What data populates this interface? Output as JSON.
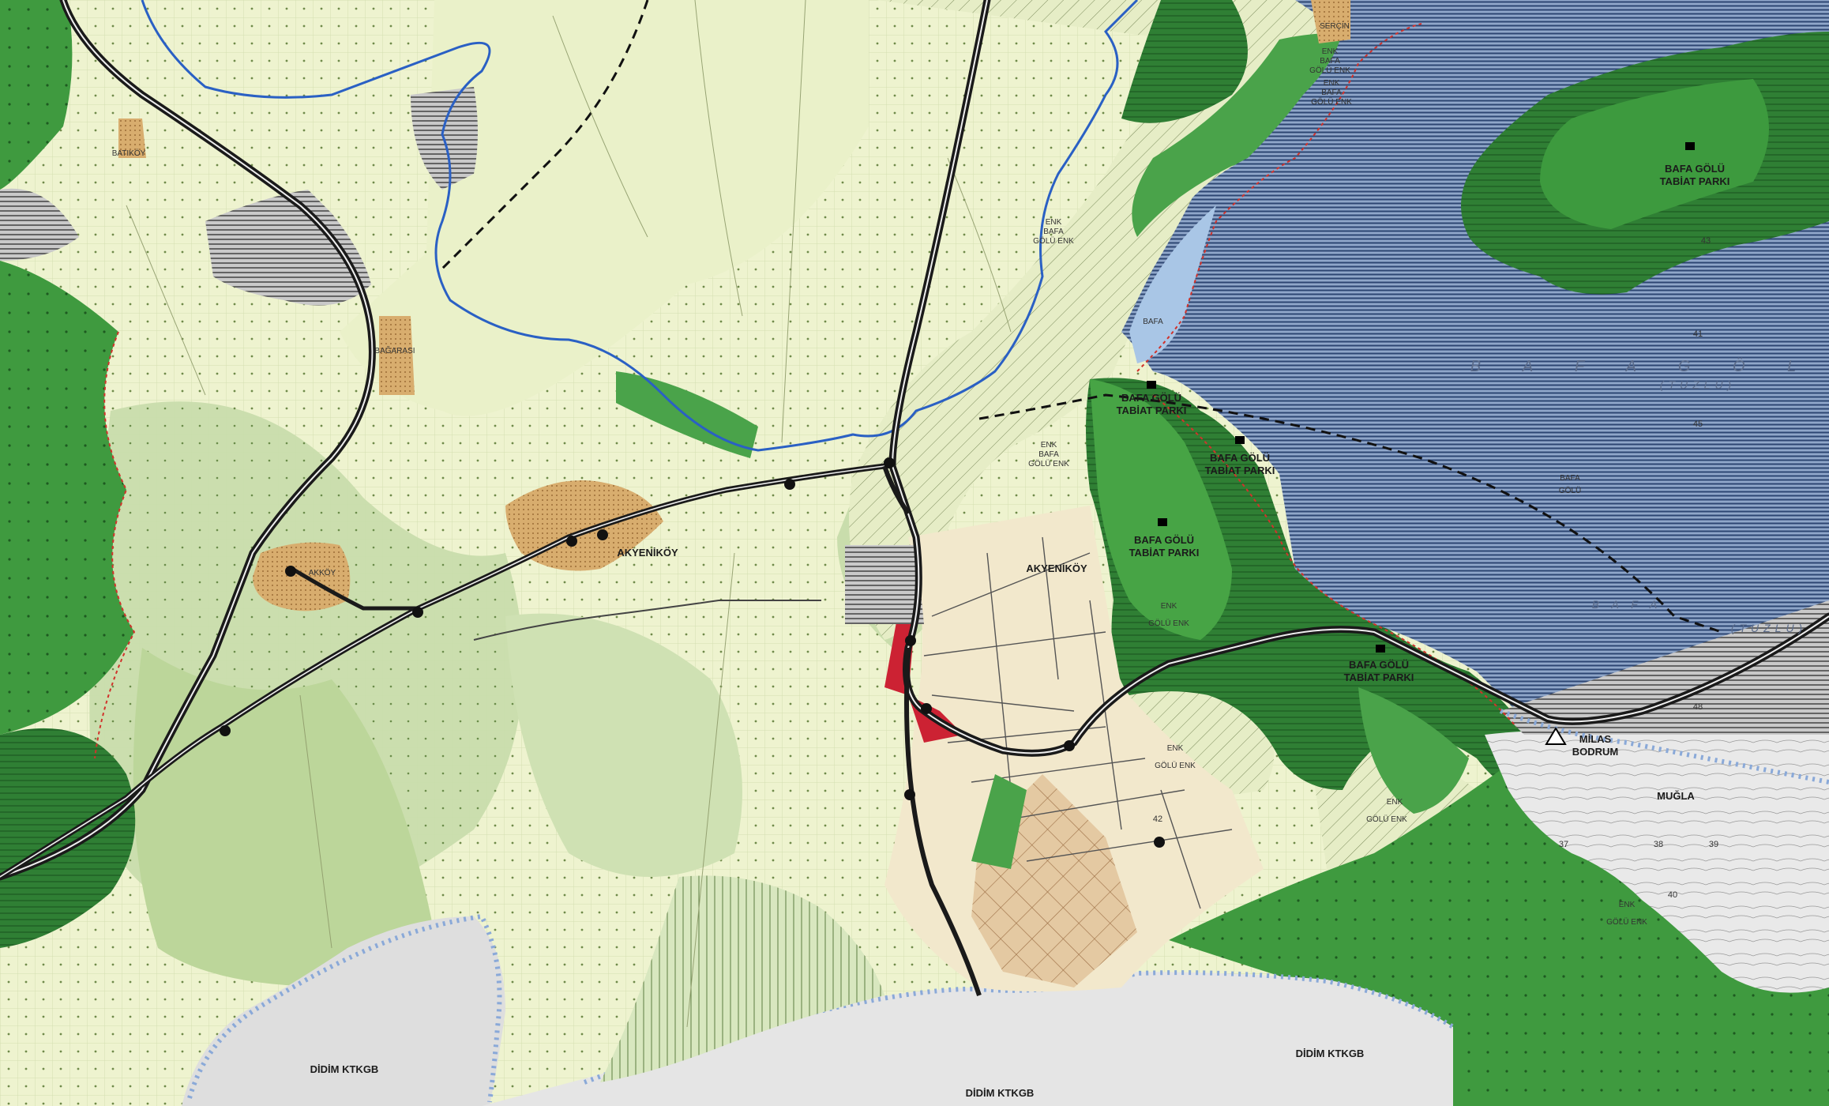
{
  "labels": {
    "batikoy": "BATIKÖY",
    "bagarasi": "BAĞARASI",
    "akyenikoy_village": "AKYENİKÖY",
    "akyenikoy_plan": "AKYENİKÖY",
    "akkoy": "AKKÖY",
    "sercin": "SERÇİN",
    "didim_left": "DİDİM KTKGB",
    "didim_center": "DİDİM KTKGB",
    "didim_right": "DİDİM KTKGB",
    "mugla": "MUĞLA",
    "milas": "MİLAS",
    "bodrum": "BODRUM",
    "bafa_lake_big": "B A F A   G Ö L",
    "bafa_lake_small": "B A F A",
    "tuzlu_1": "(TUZLU)",
    "tuzlu_2": "(TUZLU)",
    "bafa_golu_lake_1": "BAFA",
    "bafa_golu_lake_2": "GÖLÜ",
    "bafa_near_shore": "BAFA",
    "park_main_1": "BAFA GÖLÜ",
    "park_main_2": "TABİAT PARKI",
    "park_a_1": "BAFA GÖLÜ",
    "park_a_2": "TABİAT PARKI",
    "park_b_1": "BAFA GÖLÜ",
    "park_b_2": "TABİAT PARKI",
    "park_c_1": "BAFA GÖLÜ",
    "park_c_2": "TABİAT PARKI",
    "park_d_1": "BAFA GÖLÜ",
    "park_d_2": "TABİAT PARKI",
    "enk_top_1": "ENK",
    "enk_top_2": "BAFA",
    "enk_top_3": "GÖLÜ ENK",
    "enk_2_1": "ENK",
    "enk_2_2": "BAFA",
    "enk_2_3": "GÖLÜ ENK",
    "enk_3_1": "ENK",
    "enk_3_2": "BAFA",
    "enk_3_3": "GÖLÜ ENK",
    "enk_4_1": "ENK",
    "enk_4_2": "BAFA",
    "enk_4_3": "GÖLÜ ENK",
    "enk_5_1": "ENK",
    "enk_5_2": "GÖLÜ ENK",
    "enk_6_1": "ENK",
    "enk_6_2": "GÖLÜ ENK",
    "enk_7_1": "ENK",
    "enk_7_2": "GÖLÜ ENK",
    "enk_8_1": "ENK",
    "enk_8_2": "GÖLÜ ENK",
    "num_38": "38",
    "num_39": "39",
    "num_37": "37",
    "num_40": "40",
    "num_48": "48",
    "num_41": "41",
    "num_43": "43",
    "num_45": "45",
    "num_42": "42"
  },
  "colors": {
    "forest": "#3f9a3f",
    "forest_dark": "#2f7f34",
    "forest_light": "#5fb64f",
    "lake": "#3d5a8d",
    "lake_shallow": "#a9c6e6",
    "agri": "#eef3cf",
    "meadow": "#c5dca8",
    "settlement": "#d4a96a",
    "plan_area": "#f2e6c7",
    "industry": "#8b8b8b",
    "commercial": "#cc2233",
    "ktkgb": "#e7e7e7",
    "river": "#2a60c4",
    "road": "#222222"
  }
}
